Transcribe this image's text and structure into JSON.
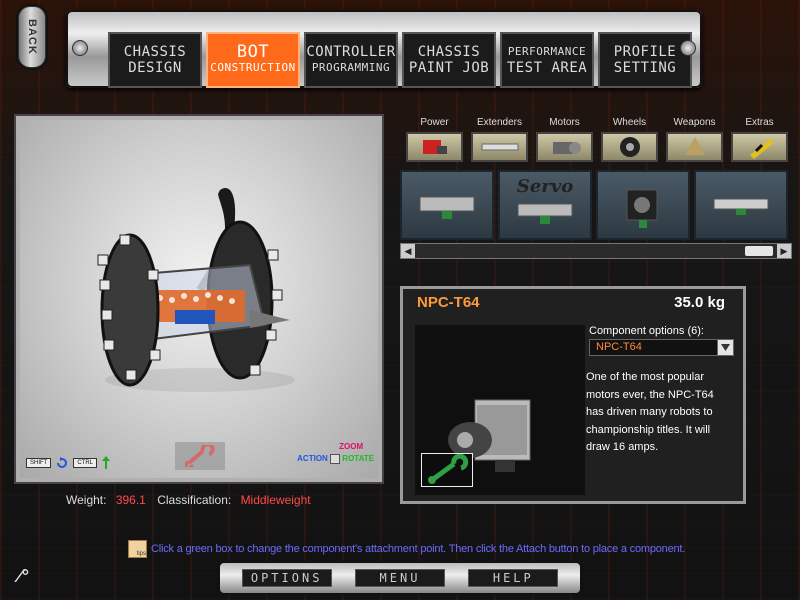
{
  "back_label": "BACK",
  "nav_tabs": [
    {
      "line1": "CHASSIS",
      "line2": "DESIGN"
    },
    {
      "line1": "BOT",
      "line2": "CONSTRUCTION"
    },
    {
      "line1": "CONTROLLER",
      "line2": "PROGRAMMING"
    },
    {
      "line1": "CHASSIS",
      "line2": "PAINT JOB"
    },
    {
      "line1": "PERFORMANCE",
      "line2": "TEST AREA"
    },
    {
      "line1": "PROFILE",
      "line2": "SETTING"
    }
  ],
  "active_tab": "BOT CONSTRUCTION",
  "viewport": {
    "shift_key": "SHIFT",
    "ctrl_key": "CTRL",
    "action_label": "ACTION",
    "zoom_label": "ZOOM",
    "rotate_label": "ROTATE"
  },
  "stats": {
    "weight_label": "Weight:",
    "weight_value": "396.1",
    "class_label": "Classification:",
    "class_value": "Middleweight"
  },
  "categories": [
    "Power",
    "Extenders",
    "Motors",
    "Wheels",
    "Weapons",
    "Extras"
  ],
  "carousel": {
    "servo_text": "Servo"
  },
  "component": {
    "name": "NPC-T64",
    "weight": "35.0 kg",
    "options_label": "Component options (6):",
    "selected_option": "NPC-T64",
    "description": "One of the most popular motors ever, the NPC-T64 has driven many robots to championship titles.  It will draw 16 amps."
  },
  "tip": {
    "icon_text": "tips",
    "text": "Click a green box to change the component's attachment point.  Then click the Attach button to place a component."
  },
  "bottom_buttons": [
    "OPTIONS",
    "MENU",
    "HELP"
  ],
  "colors": {
    "accent_orange": "#ff6a1a",
    "name_orange": "#ff9a3a",
    "weight_red": "#ff4a4a",
    "tip_blue": "#6a6aff"
  }
}
